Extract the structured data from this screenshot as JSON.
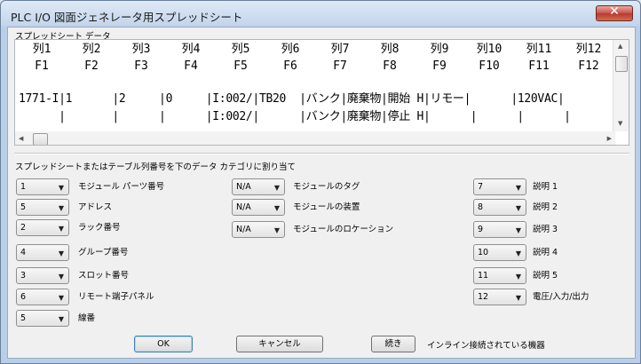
{
  "window": {
    "title": "PLC I/O 図面ジェネレータ用スプレッドシート",
    "close_label": "✕"
  },
  "spreadsheet": {
    "label": "スプレッドシート データ",
    "columns": [
      {
        "name": "列1",
        "field": "F1"
      },
      {
        "name": "列2",
        "field": "F2"
      },
      {
        "name": "列3",
        "field": "F3"
      },
      {
        "name": "列4",
        "field": "F4"
      },
      {
        "name": "列5",
        "field": "F5"
      },
      {
        "name": "列6",
        "field": "F6"
      },
      {
        "name": "列7",
        "field": "F7"
      },
      {
        "name": "列8",
        "field": "F8"
      },
      {
        "name": "列9",
        "field": "F9"
      },
      {
        "name": "列10",
        "field": "F10"
      },
      {
        "name": "列11",
        "field": "F11"
      },
      {
        "name": "列12",
        "field": "F12"
      }
    ],
    "rows": [
      "1771-I|1      |2     |0     |I:002/|TB20  |バンク|廃棄物|開始 H|リモー|      |120VAC|",
      "      |       |      |      |I:002/|      |バンク|廃棄物|停止 H|      |      |      |"
    ]
  },
  "assign_label": "スプレッドシートまたはテーブル列番号を下のデータ カテゴリに割り当て",
  "fields_left": [
    {
      "value": "1",
      "label": "モジュール パーツ番号"
    },
    {
      "value": "5",
      "label": "アドレス"
    },
    {
      "value": "2",
      "label": "ラック番号"
    },
    {
      "value": "4",
      "label": "グループ番号"
    },
    {
      "value": "3",
      "label": "スロット番号"
    },
    {
      "value": "6",
      "label": "リモート端子パネル"
    },
    {
      "value": "5",
      "label": "線番"
    }
  ],
  "fields_mid": [
    {
      "value": "N/A",
      "label": "モジュールのタグ"
    },
    {
      "value": "N/A",
      "label": "モジュールの装置"
    },
    {
      "value": "N/A",
      "label": "モジュールのロケーション"
    }
  ],
  "fields_right": [
    {
      "value": "7",
      "label": "説明 1"
    },
    {
      "value": "8",
      "label": "説明 2"
    },
    {
      "value": "9",
      "label": "説明 3"
    },
    {
      "value": "10",
      "label": "説明 4"
    },
    {
      "value": "11",
      "label": "説明 5"
    },
    {
      "value": "12",
      "label": "電圧/入力/出力"
    }
  ],
  "buttons": {
    "ok": "OK",
    "cancel": "キャンセル",
    "continue": "続き",
    "continue_desc": "インライン接続されている機器"
  }
}
